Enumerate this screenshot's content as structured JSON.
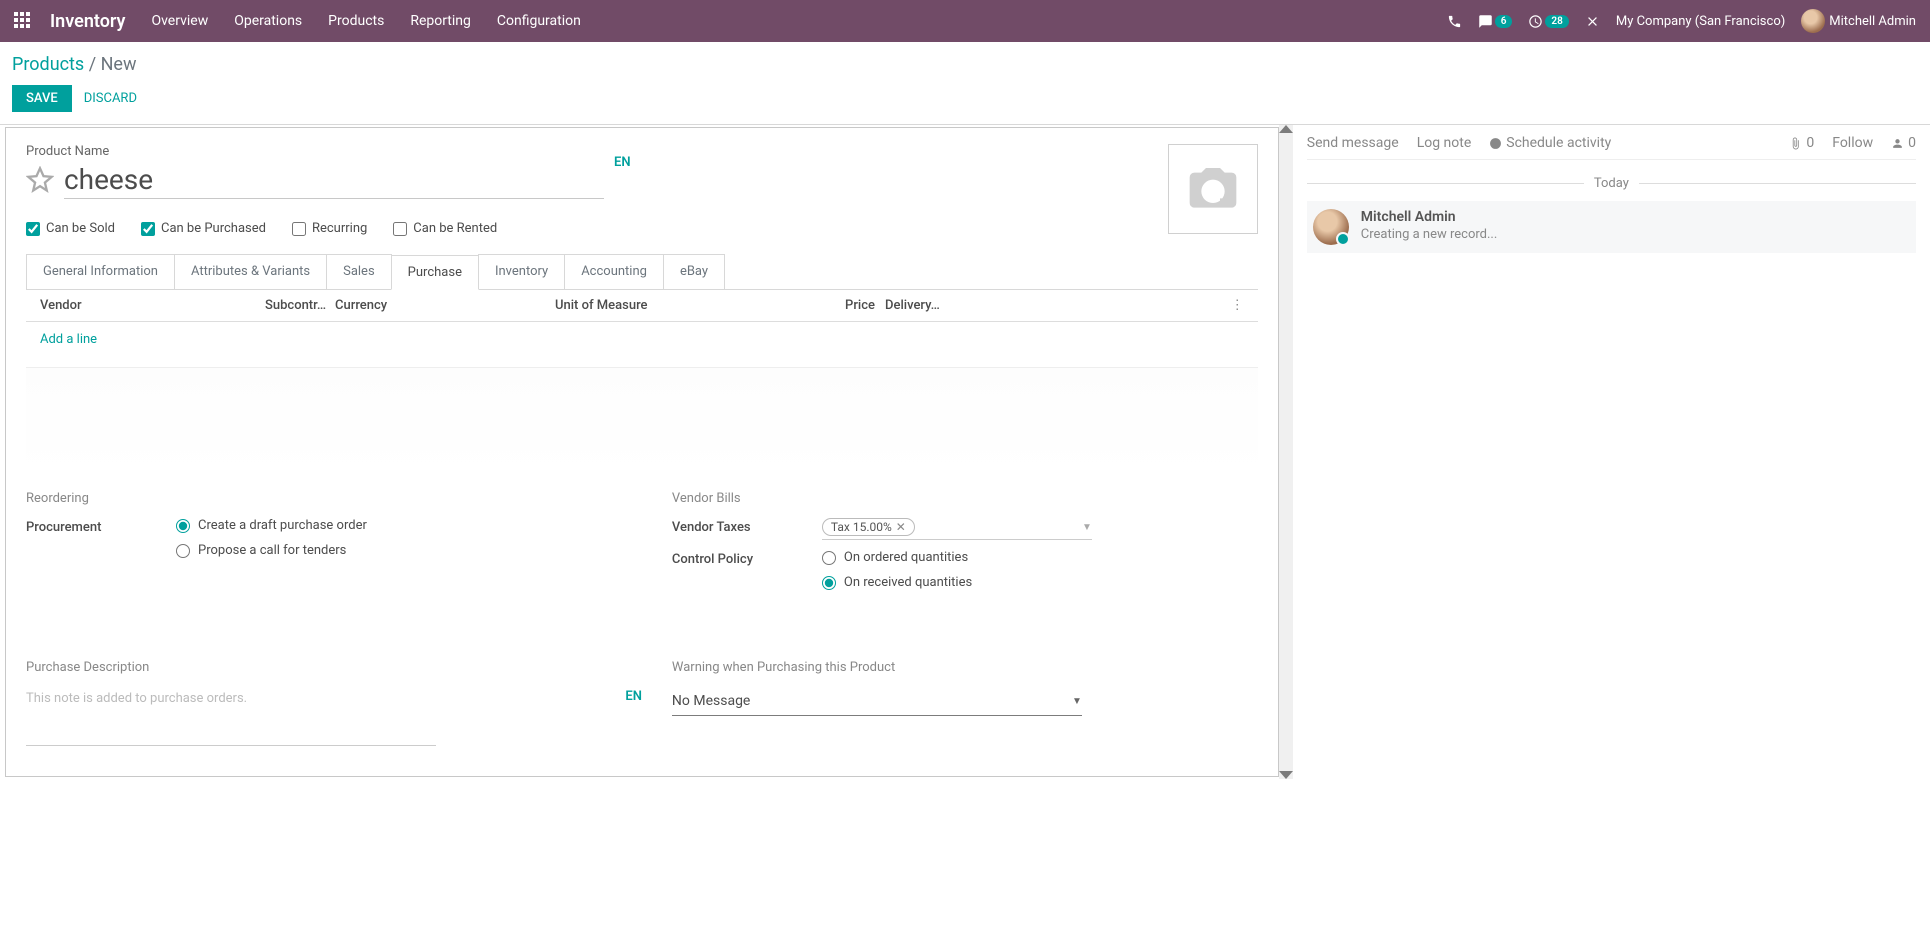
{
  "navbar": {
    "brand": "Inventory",
    "menu": [
      "Overview",
      "Operations",
      "Products",
      "Reporting",
      "Configuration"
    ],
    "messages_badge": "6",
    "activities_badge": "28",
    "company": "My Company (San Francisco)",
    "user": "Mitchell Admin"
  },
  "breadcrumb": {
    "root": "Products",
    "sep": " / ",
    "current": "New"
  },
  "actions": {
    "save": "SAVE",
    "discard": "DISCARD"
  },
  "form": {
    "name_label": "Product Name",
    "name_value": "cheese",
    "lang": "EN",
    "checkboxes": {
      "sold": {
        "label": "Can be Sold",
        "checked": true
      },
      "purchased": {
        "label": "Can be Purchased",
        "checked": true
      },
      "recurring": {
        "label": "Recurring",
        "checked": false
      },
      "rented": {
        "label": "Can be Rented",
        "checked": false
      }
    },
    "tabs": [
      "General Information",
      "Attributes & Variants",
      "Sales",
      "Purchase",
      "Inventory",
      "Accounting",
      "eBay"
    ],
    "active_tab": "Purchase",
    "vendor_table": {
      "headers": {
        "vendor": "Vendor",
        "subcontr": "Subcontr…",
        "currency": "Currency",
        "uom": "Unit of Measure",
        "price": "Price",
        "delivery": "Delivery…"
      },
      "add_line": "Add a line"
    },
    "reordering": {
      "title": "Reordering",
      "procurement_label": "Procurement",
      "opt_draft": "Create a draft purchase order",
      "opt_tender": "Propose a call for tenders"
    },
    "vendor_bills": {
      "title": "Vendor Bills",
      "taxes_label": "Vendor Taxes",
      "tax_tag": "Tax 15.00%",
      "control_label": "Control Policy",
      "opt_ordered": "On ordered quantities",
      "opt_received": "On received quantities"
    },
    "purchase_desc": {
      "label": "Purchase Description",
      "placeholder": "This note is added to purchase orders.",
      "lang": "EN"
    },
    "warning": {
      "label": "Warning when Purchasing this Product",
      "value": "No Message"
    }
  },
  "chat": {
    "send": "Send message",
    "log": "Log note",
    "schedule": "Schedule activity",
    "attach_count": "0",
    "follow": "Follow",
    "follower_count": "0",
    "day": "Today",
    "message": {
      "author": "Mitchell Admin",
      "body": "Creating a new record..."
    }
  }
}
